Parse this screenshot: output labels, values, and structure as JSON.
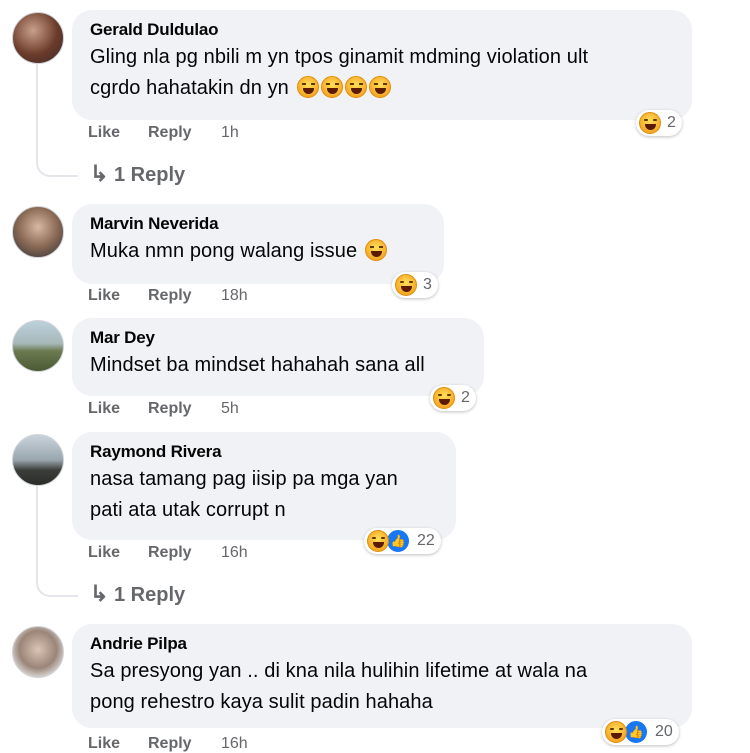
{
  "comments": [
    {
      "name": "Gerald Duldulao",
      "text_line1": "Gling nla pg nbili m yn tpos ginamit mdming violation ult",
      "text_line2": "cgrdo hahatakin dn yn",
      "like": "Like",
      "reply": "Reply",
      "time": "1h",
      "reaction_count": "2",
      "replies_label": "1 Reply"
    },
    {
      "name": "Marvin Neverida",
      "text_line1": "Muka nmn pong walang issue",
      "like": "Like",
      "reply": "Reply",
      "time": "18h",
      "reaction_count": "3"
    },
    {
      "name": "Mar Dey",
      "text_line1": "Mindset ba mindset hahahah sana all",
      "like": "Like",
      "reply": "Reply",
      "time": "5h",
      "reaction_count": "2"
    },
    {
      "name": "Raymond Rivera",
      "text_line1": "nasa tamang pag iisip pa mga yan",
      "text_line2": "pati ata utak corrupt n",
      "like": "Like",
      "reply": "Reply",
      "time": "16h",
      "reaction_count": "22",
      "replies_label": "1 Reply"
    },
    {
      "name": "Andrie Pilpa",
      "text_line1": "Sa presyong yan .. di kna nila hulihin lifetime at wala na",
      "text_line2": "pong rehestro kaya sulit padin hahaha",
      "like": "Like",
      "reply": "Reply",
      "time": "16h",
      "reaction_count": "20"
    }
  ],
  "colors": {
    "bubble": "#f0f2f5",
    "meta": "#65676b",
    "like_blue": "#1877f2",
    "haha": "#f7b125"
  },
  "icons": [
    "haha-emoji-icon",
    "like-thumb-icon",
    "reply-arrow-icon"
  ]
}
